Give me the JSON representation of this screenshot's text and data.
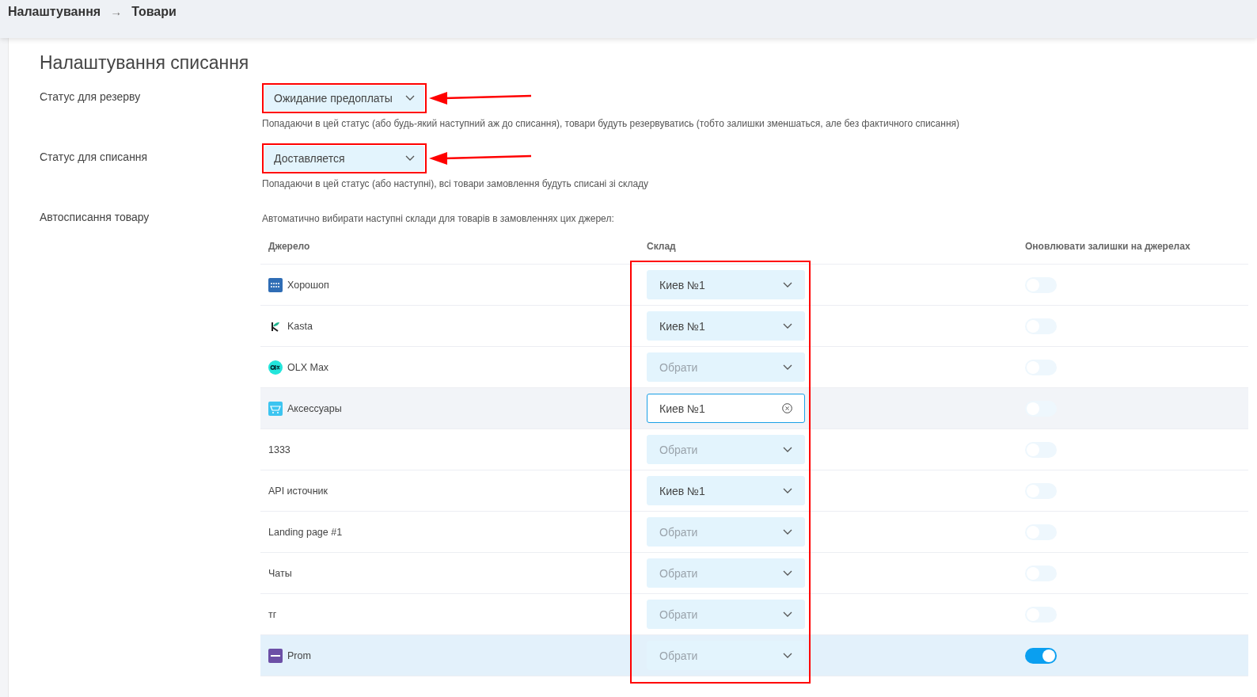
{
  "breadcrumb": [
    {
      "label": "Налаштування"
    },
    {
      "label": "Товари"
    }
  ],
  "breadcrumb_separator": "→",
  "section_title": "Налаштування списання",
  "settings": [
    {
      "label": "Статус для резерву",
      "value": "Ожидание предоплаты",
      "hint": "Попадаючи в цей статус (або будь-який наступний аж до списання), товари будуть резервуватись (тобто залишки зменшаться, але без фактичного списання)"
    },
    {
      "label": "Статус для списання",
      "value": "Доставляется",
      "hint": "Попадаючи в цей статус (або наступні), всі товари замовлення будуть списані зі складу"
    }
  ],
  "auto_writeoff": {
    "label": "Автосписання товару",
    "hint": "Автоматично вибирати наступні склади для товарів в замовленнях цих джерел:"
  },
  "table": {
    "columns": [
      "Джерело",
      "Склад",
      "Оновлювати залишки на джерелах"
    ],
    "rows": [
      {
        "kind": "horoshop",
        "source": "Хорошоп",
        "warehouse": "Киев №1",
        "focused": false,
        "hovered": false,
        "selected": false,
        "on": false
      },
      {
        "kind": "kasta",
        "source": "Kasta",
        "warehouse": "Киев №1",
        "focused": false,
        "hovered": false,
        "selected": false,
        "on": false
      },
      {
        "kind": "olx",
        "source": "OLX Max",
        "placeholder": "Обрати",
        "focused": false,
        "hovered": false,
        "selected": false,
        "on": false
      },
      {
        "kind": "cart",
        "source": "Аксессуары",
        "warehouse": "Киев №1",
        "focused": true,
        "hovered": true,
        "selected": false,
        "on": false
      },
      {
        "kind": "plain",
        "source": "1333",
        "placeholder": "Обрати",
        "focused": false,
        "hovered": false,
        "selected": false,
        "on": false
      },
      {
        "kind": "plain",
        "source": "API источник",
        "warehouse": "Киев №1",
        "focused": false,
        "hovered": false,
        "selected": false,
        "on": false
      },
      {
        "kind": "plain",
        "source": "Landing page #1",
        "placeholder": "Обрати",
        "focused": false,
        "hovered": false,
        "selected": false,
        "on": false
      },
      {
        "kind": "plain",
        "source": "Чаты",
        "placeholder": "Обрати",
        "focused": false,
        "hovered": false,
        "selected": false,
        "on": false
      },
      {
        "kind": "plain",
        "source": "тг",
        "placeholder": "Обрати",
        "focused": false,
        "hovered": false,
        "selected": false,
        "on": false
      },
      {
        "kind": "prom",
        "source": "Prom",
        "placeholder": "Обрати",
        "focused": false,
        "hovered": false,
        "selected": true,
        "on": true
      }
    ]
  }
}
